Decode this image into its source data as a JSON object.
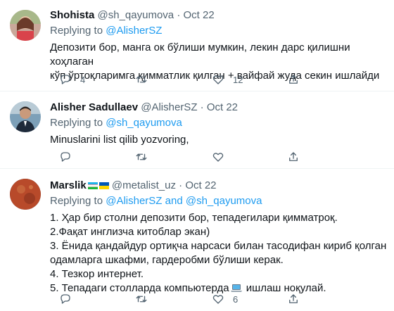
{
  "tweets": [
    {
      "display_name": "Shohista",
      "handle": "@sh_qayumova",
      "dot": "·",
      "date": "Oct 22",
      "replying_label": "Replying to",
      "replying_to": "@AlisherSZ",
      "text_lines": [
        "Депозити бор, манга ок бўлиши мумкин, лекин дарс қилишни хоҳлаган",
        "кўп ўртоқларимга қимматлик қилган + вайфай жуда секин ишлайди"
      ],
      "replies": "4",
      "retweets": "",
      "likes": "12"
    },
    {
      "display_name": "Alisher Sadullaev",
      "handle": "@AlisherSZ",
      "dot": "·",
      "date": "Oct 22",
      "replying_label": "Replying to",
      "replying_to": "@sh_qayumova",
      "text_lines": [
        "Minuslarini list qilib yozvoring,"
      ],
      "replies": "",
      "retweets": "",
      "likes": ""
    },
    {
      "display_name": "Marslik",
      "handle": "@metalist_uz",
      "dot": "·",
      "date": "Oct 22",
      "replying_label": "Replying to",
      "replying_to_1": "@AlisherSZ",
      "replying_and": "and",
      "replying_to_2": "@sh_qayumova",
      "text_lines": [
        "1. Ҳар бир столни депозити бор, тепадегилари қимматроқ.",
        "2.Фақат инглизча китоблар экан)",
        "3. Ёнида қандайдур ортиқча нарсаси билан тасодифан кириб қолган",
        "одамларга шкафми, гардеробми бўлиши керак.",
        "4. Тезкор интернет."
      ],
      "line5_before": "5. Тепадаги столларда компьютерда",
      "line5_after": "ишлаш ноқулай.",
      "replies": "",
      "retweets": "",
      "likes": "6"
    }
  ],
  "colors": {
    "link": "#1d9bf0",
    "muted": "#536471",
    "text": "#0f1419",
    "divider": "#eff3f4"
  },
  "icons": [
    "reply-icon",
    "retweet-icon",
    "like-icon",
    "share-icon",
    "uzbekistan-flag-icon",
    "ukraine-flag-icon",
    "laptop-icon"
  ]
}
